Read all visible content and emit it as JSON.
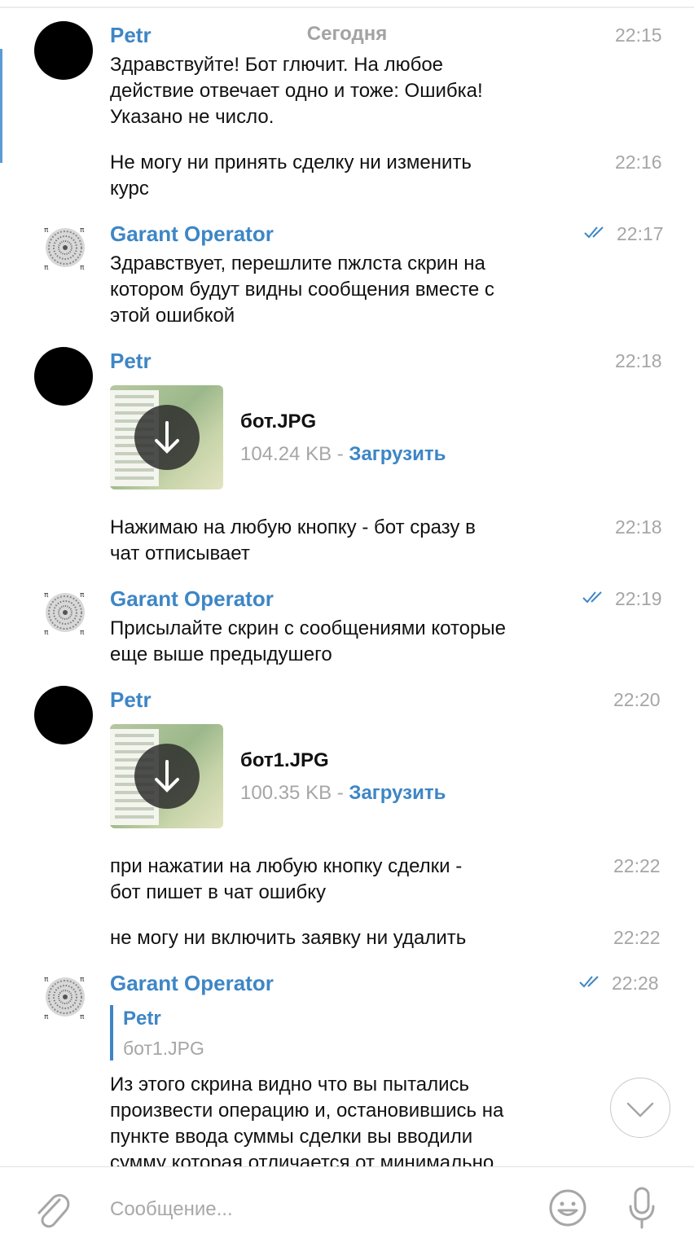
{
  "date_separator": "Сегодня",
  "messages": [
    {
      "sender": "Petr",
      "time": "22:15",
      "text": "Здравствуйте! Бот глючит. На любое\nдействие отвечает одно и тоже:  Ошибка!\nУказано не число."
    },
    {
      "time": "22:16",
      "text": "Не могу ни принять сделку ни изменить\nкурс"
    },
    {
      "sender": "Garant Operator",
      "time": "22:17",
      "text": "Здравствует, перешлите пжлста скрин на\nкотором будут видны сообщения вместе с\nэтой ошибкой"
    },
    {
      "sender": "Petr",
      "time": "22:18",
      "file": {
        "name": "бот.JPG",
        "size": "104.24 KB - ",
        "action": "Загрузить"
      }
    },
    {
      "time": "22:18",
      "text": "Нажимаю на любую кнопку - бот сразу в\nчат отписывает"
    },
    {
      "sender": "Garant Operator",
      "time": "22:19",
      "text": "Присылайте скрин с сообщениями которые\nеще выше предыдушего"
    },
    {
      "sender": "Petr",
      "time": "22:20",
      "file": {
        "name": "бот1.JPG",
        "size": "100.35 KB - ",
        "action": "Загрузить"
      }
    },
    {
      "time": "22:22",
      "text": "при нажатии на любую кнопку сделки -\nбот пишет в чат ошибку"
    },
    {
      "time": "22:22",
      "text": "не могу ни включить заявку ни удалить"
    },
    {
      "sender": "Garant Operator",
      "time": "22:28",
      "reply": {
        "name": "Petr",
        "text": "бот1.JPG"
      },
      "text": "Из этого скрина видно что вы пытались\nпроизвести операцию и, остановившись на\nпункте ввода суммы сделки вы вводили\nсумму которая отличается от минимально"
    }
  ],
  "composer": {
    "placeholder": "Сообщение..."
  },
  "icons": {
    "attach": "paperclip-icon",
    "emoji": "smiley-icon",
    "mic": "microphone-icon",
    "scroll": "chevron-down-icon",
    "read": "double-check-icon",
    "download": "download-arrow-icon"
  },
  "colors": {
    "accent": "#3d86c6",
    "time": "#a6a6a6"
  }
}
